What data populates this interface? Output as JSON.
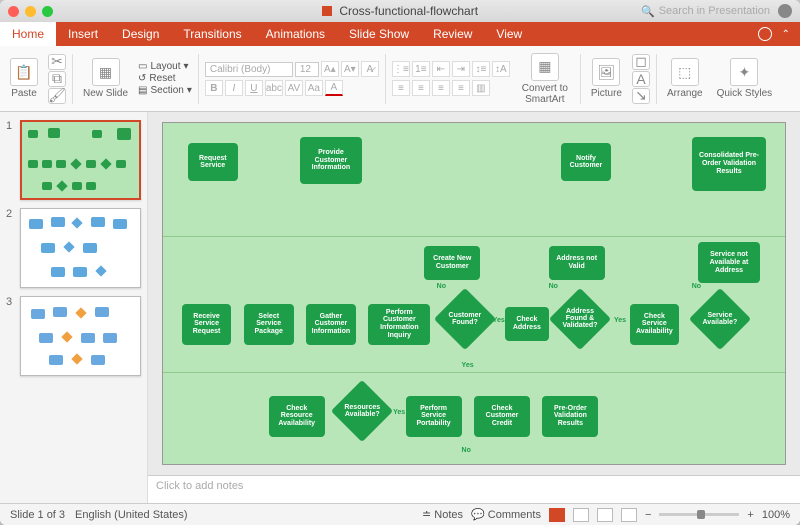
{
  "window": {
    "title": "Cross-functional-flowchart",
    "search_placeholder": "Search in Presentation"
  },
  "tabs": [
    "Home",
    "Insert",
    "Design",
    "Transitions",
    "Animations",
    "Slide Show",
    "Review",
    "View"
  ],
  "active_tab": "Home",
  "ribbon": {
    "paste": "Paste",
    "new_slide": "New Slide",
    "layout": "Layout",
    "reset": "Reset",
    "section": "Section",
    "font_name": "Calibri (Body)",
    "font_size": "12",
    "convert": "Convert to SmartArt",
    "picture": "Picture",
    "arrange": "Arrange",
    "quick_styles": "Quick Styles"
  },
  "thumbnails": [
    {
      "num": "1",
      "selected": true
    },
    {
      "num": "2",
      "selected": false
    },
    {
      "num": "3",
      "selected": false
    }
  ],
  "flowchart": {
    "row1": {
      "request_service": "Request Service",
      "provide_info": "Provide Customer Information",
      "notify": "Notify Customer",
      "consolidated": "Consolidated Pre-Order Validation Results"
    },
    "row_mid": {
      "create_new": "Create New Customer",
      "addr_not_valid": "Address not Valid",
      "svc_not_avail": "Service not Available at Address"
    },
    "row2": {
      "receive": "Receive Service Request",
      "select_pkg": "Select Service Package",
      "gather": "Gather Customer Information",
      "perform_inquiry": "Perform Customer Information Inquiry",
      "cust_found": "Customer Found?",
      "check_addr": "Check Address",
      "addr_found": "Address Found & Validated?",
      "check_svc": "Check Service Availability",
      "svc_avail": "Service Available?"
    },
    "row3": {
      "check_res": "Check Resource Availability",
      "res_avail": "Resources Available?",
      "perform_port": "Perform Service Portability",
      "check_credit": "Check Customer Credit",
      "preorder": "Pre-Order Validation Results"
    },
    "labels": {
      "yes": "Yes",
      "no": "No"
    }
  },
  "notes_placeholder": "Click to add notes",
  "status": {
    "slide": "Slide 1 of 3",
    "lang": "English (United States)",
    "notes": "Notes",
    "comments": "Comments",
    "zoom": "100%"
  }
}
